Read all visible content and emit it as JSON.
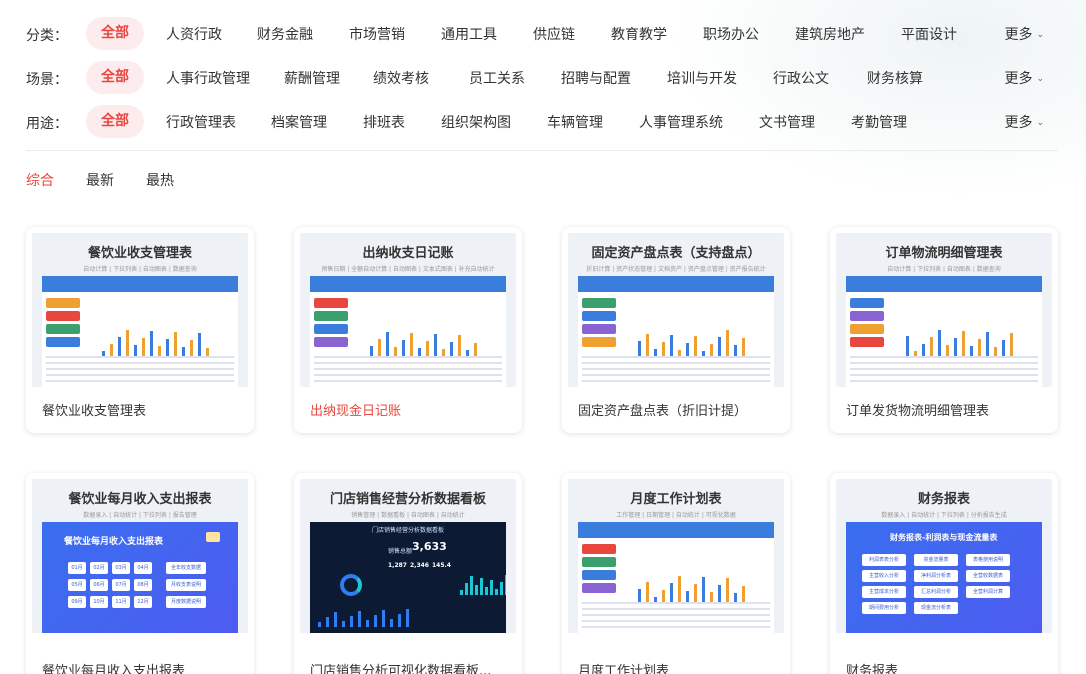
{
  "filters": [
    {
      "label": "分类：",
      "active": "全部",
      "items": [
        "人资行政",
        "财务金融",
        "市场营销",
        "通用工具",
        "供应链",
        "教育教学",
        "职场办公",
        "建筑房地产",
        "平面设计"
      ],
      "more": "更多"
    },
    {
      "label": "场景：",
      "active": "全部",
      "items": [
        "人事行政管理",
        "薪酬管理",
        "绩效考核",
        "员工关系",
        "招聘与配置",
        "培训与开发",
        "行政公文",
        "财务核算"
      ],
      "more": "更多"
    },
    {
      "label": "用途：",
      "active": "全部",
      "items": [
        "行政管理表",
        "档案管理",
        "排班表",
        "组织架构图",
        "车辆管理",
        "人事管理系统",
        "文书管理",
        "考勤管理"
      ],
      "more": "更多"
    }
  ],
  "sort": [
    "综合",
    "最新",
    "最热"
  ],
  "cards": [
    {
      "thumb_title": "餐饮业收支管理表",
      "thumb_sub": "自动计算 | 下拉列表 | 自动图表 | 数据查询",
      "name": "餐饮业收支管理表",
      "highlight": false,
      "style": "light"
    },
    {
      "thumb_title": "出纳收支日记账",
      "thumb_sub": "预售日期 | 全额自动计算 | 自动图表 | 文本式图表 | 补充自动统计",
      "name": "出纳现金日记账",
      "highlight": true,
      "style": "light"
    },
    {
      "thumb_title": "固定资产盘点表（支持盘点）",
      "thumb_sub": "折旧计算 | 资产状态管理 | 文档资产 | 资产盘点管理 | 资产报告统计",
      "name": "固定资产盘点表（折旧计提）",
      "highlight": false,
      "style": "light"
    },
    {
      "thumb_title": "订单物流明细管理表",
      "thumb_sub": "自动计算 | 下拉列表 | 自动图表 | 数据查询",
      "name": "订单发货物流明细管理表",
      "highlight": false,
      "style": "light"
    },
    {
      "thumb_title": "餐饮业每月收入支出报表",
      "thumb_sub": "数据录入 | 自动统计 | 下拉列表 | 报告管理",
      "name": "餐饮业每月收入支出报表",
      "highlight": false,
      "style": "blue",
      "inner_title": "餐饮业每月收入支出报表",
      "months": [
        "01月",
        "02月",
        "03月",
        "04月",
        "05月",
        "06月",
        "07月",
        "08月",
        "09月",
        "10月",
        "11月",
        "12月"
      ],
      "links": [
        "全年收支数据",
        "月收支表说明",
        "月度数据说明"
      ]
    },
    {
      "thumb_title": "门店销售经营分析数据看板",
      "thumb_sub": "销售管理 | 数据看板 | 自动图表 | 自动统计",
      "name": "门店销售分析可视化数据看板...",
      "highlight": false,
      "style": "dark",
      "dash_title": "门店销售经营分析数据看板",
      "dash_label": "销售总额",
      "dash_value": "3,633",
      "dash_small": [
        "1,287",
        "2,346",
        "145.4"
      ]
    },
    {
      "thumb_title": "月度工作计划表",
      "thumb_sub": "工作管理 | 日期管理 | 自动统计 | 可视化数据",
      "name": "月度工作计划表",
      "highlight": false,
      "style": "light"
    },
    {
      "thumb_title": "财务报表",
      "thumb_sub": "数据录入 | 自动统计 | 下拉列表 | 分析报告生成",
      "name": "财务报表",
      "highlight": false,
      "style": "blue2",
      "inner_title": "财务报表-利润表与现金流量表",
      "links": [
        "利润表表分析",
        "资金流量表",
        "表格使用说明",
        "主营收入分析",
        "净利润分析表",
        "全营收数据表",
        "主营成本分析",
        "汇总利润分析",
        "全营利润计算",
        "期间费用分析",
        "现金流分析表"
      ]
    }
  ],
  "colors": {
    "accent": "#e8473f",
    "accent_bg": "#fdecee",
    "blue": "#3b7ddd"
  }
}
